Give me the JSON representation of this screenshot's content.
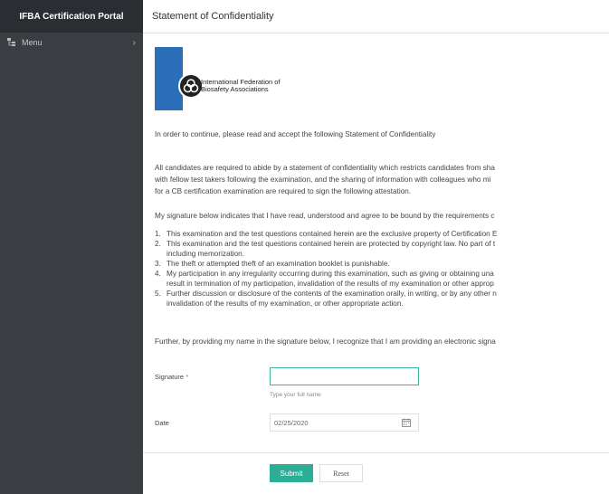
{
  "sidebar": {
    "brand": "IFBA Certification Portal",
    "menu_label": "Menu",
    "menu_chevron": "›"
  },
  "header": {
    "title": "Statement of Confidentiality"
  },
  "logo": {
    "line1": "International Federation of",
    "line2": "Biosafety Associations"
  },
  "content": {
    "intro": "In order to continue, please read and accept the following Statement of Confidentiality",
    "para1": [
      "All candidates are required to abide by a statement of confidentiality which restricts candidates from sha",
      "with fellow test takers following the examination, and the sharing of information with colleagues who mi",
      "for a CB certification examination are required to sign the following attestation."
    ],
    "para2": "My signature below indicates that I have read, understood and agree to be bound by the requirements c",
    "list": [
      {
        "num": "1.",
        "lines": [
          "This examination and the test questions contained herein are the exclusive property of Certification E"
        ]
      },
      {
        "num": "2.",
        "lines": [
          "This examination and the test questions contained herein are protected by copyright law. No part of t",
          "including memorization."
        ]
      },
      {
        "num": "3.",
        "lines": [
          "The theft or attempted theft of an examination booklet is punishable."
        ]
      },
      {
        "num": "4.",
        "lines": [
          "My participation in any irregularity occurring during this examination, such as giving or obtaining una",
          "result in termination of my participation, invalidation of the results of my examination or other approp"
        ]
      },
      {
        "num": "5.",
        "lines": [
          "Further discussion or disclosure of the contents of the examination orally, in writing, or by any other n",
          "invalidation of the results of my examination, or other appropriate action."
        ]
      }
    ],
    "para3": "Further, by providing my name in the signature below, I recognize that I am providing an electronic signa"
  },
  "form": {
    "signature_label": "Signature",
    "required_mark": "*",
    "signature_value": "",
    "signature_hint": "Type your full name",
    "date_label": "Date",
    "date_value": "02/25/2020",
    "submit_label": "Submit",
    "reset_label": "Reset"
  },
  "colors": {
    "sidebar_bg": "#3a3e42",
    "brand_bg": "#2a2d31",
    "accent": "#2cae96"
  }
}
